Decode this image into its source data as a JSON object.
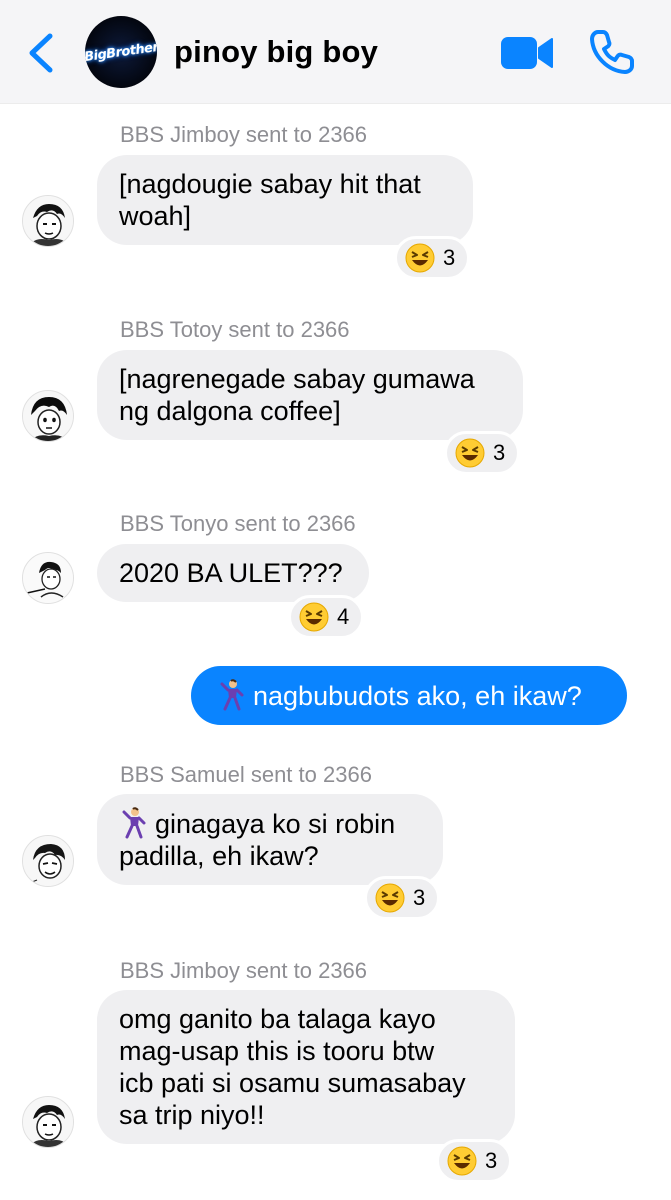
{
  "header": {
    "back_label": "Back",
    "title": "pinoy big boy",
    "group_logo_text": "BigBrother",
    "accent": "#0a84ff"
  },
  "messages": [
    {
      "sender": "BBS Jimboy sent to 2366",
      "lines": [
        "[nagdougie sabay hit that",
        "woah]"
      ],
      "reaction": {
        "emoji": "laughing-face",
        "count": "3"
      }
    },
    {
      "sender": "BBS Totoy sent to 2366",
      "lines": [
        "[nagrenegade sabay gumawa",
        "ng dalgona coffee]"
      ],
      "reaction": {
        "emoji": "laughing-face",
        "count": "3"
      }
    },
    {
      "sender": "BBS Tonyo sent to 2366",
      "lines": [
        "2020 BA ULET???"
      ],
      "reaction": {
        "emoji": "laughing-face",
        "count": "4"
      }
    },
    {
      "sender": "",
      "lines": [
        "nagbubudots ako, eh ikaw?"
      ],
      "outgoing": true,
      "prefix_emoji": "dancer"
    },
    {
      "sender": "BBS Samuel sent to 2366",
      "lines": [
        "ginagaya ko si robin",
        "padilla, eh ikaw?"
      ],
      "prefix_emoji": "dancer",
      "reaction": {
        "emoji": "laughing-face",
        "count": "3"
      }
    },
    {
      "sender": "BBS Jimboy sent to 2366",
      "lines": [
        "omg ganito ba talaga kayo",
        "mag-usap this is tooru btw",
        "icb pati si osamu sumasabay",
        "sa trip niyo!!"
      ],
      "reaction": {
        "emoji": "laughing-face",
        "count": "3"
      }
    }
  ]
}
